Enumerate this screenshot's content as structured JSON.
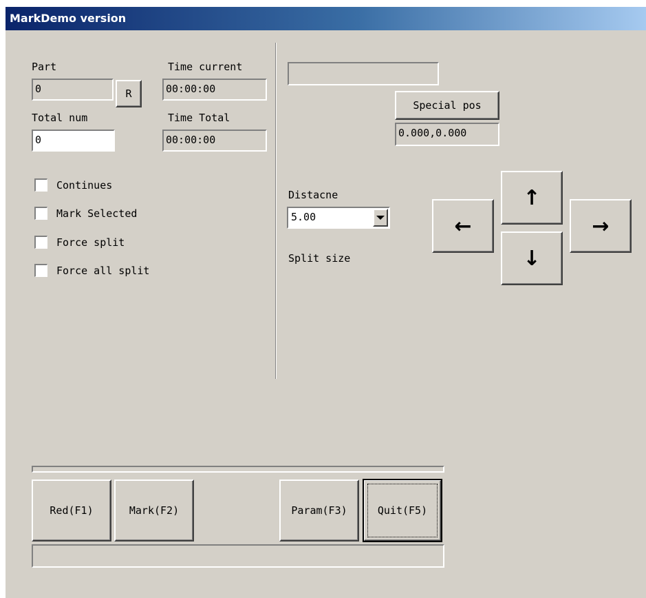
{
  "window": {
    "title": "MarkDemo version"
  },
  "left": {
    "part_label": "Part",
    "part_value": "0",
    "r_button": "R",
    "time_current_label": "Time current",
    "time_current_value": "00:00:00",
    "total_num_label": "Total num",
    "total_num_value": "0",
    "time_total_label": "Time Total",
    "time_total_value": "00:00:00",
    "checkboxes": [
      {
        "label": "Continues",
        "checked": false
      },
      {
        "label": "Mark Selected",
        "checked": false
      },
      {
        "label": "Force split",
        "checked": false
      },
      {
        "label": "Force all split",
        "checked": false
      }
    ]
  },
  "right": {
    "top_field_value": "",
    "special_pos_button": "Special pos",
    "special_pos_value": "0.000,0.000",
    "distance_label": "Distacne",
    "distance_value": "5.00",
    "split_size_label": "Split size",
    "arrows": {
      "up": "↑",
      "down": "↓",
      "left": "←",
      "right": "→"
    }
  },
  "bottom": {
    "buttons": {
      "red": "Red(F1)",
      "mark": "Mark(F2)",
      "param": "Param(F3)",
      "quit": "Quit(F5)"
    },
    "status_value": ""
  }
}
